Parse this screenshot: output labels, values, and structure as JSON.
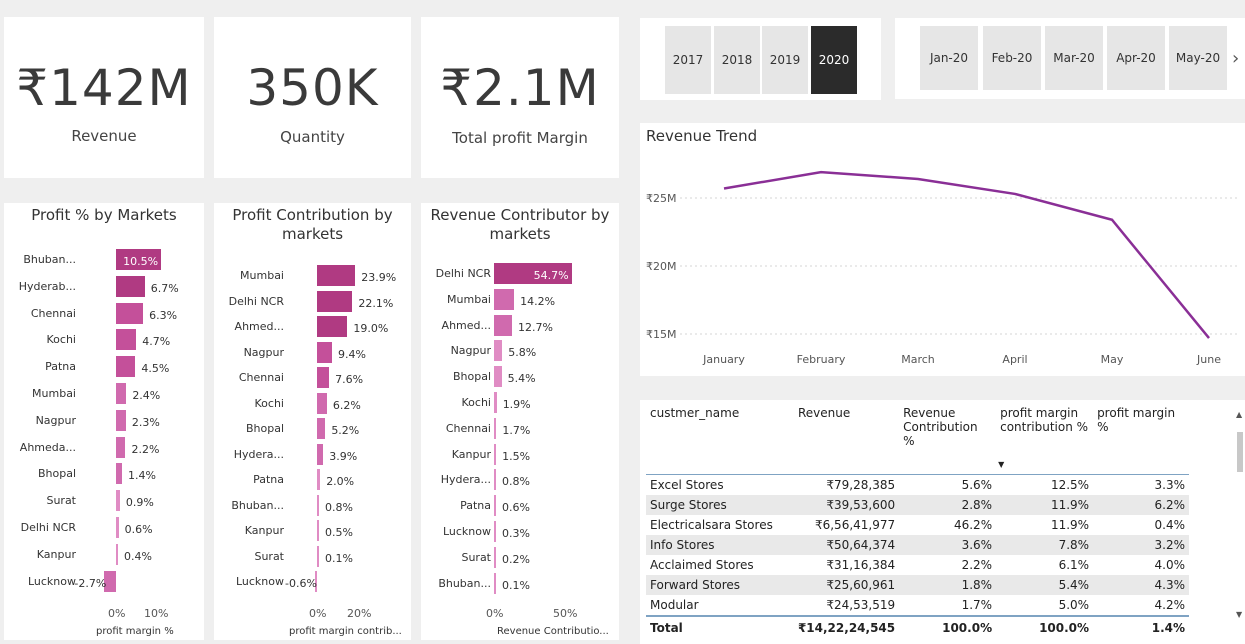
{
  "kpis": [
    {
      "value": "₹142M",
      "label": "Revenue"
    },
    {
      "value": "350K",
      "label": "Quantity"
    },
    {
      "value": "₹2.1M",
      "label": "Total profit Margin"
    }
  ],
  "slicers": {
    "years": [
      "2017",
      "2018",
      "2019",
      "2020"
    ],
    "selected_year": "2020",
    "months": [
      "Jan-20",
      "Feb-20",
      "Mar-20",
      "Apr-20",
      "May-20"
    ]
  },
  "colors": {
    "bar_strong": "#b03a82",
    "bar_mid": "#c4509a",
    "bar_light": "#e08cc4",
    "line": "#8a2f96",
    "selected_btn": "#2b2b2b"
  },
  "chart_data": [
    {
      "type": "bar",
      "orientation": "horizontal",
      "title": "Profit % by Markets",
      "xlabel": "profit margin %",
      "categories": [
        "Bhuban...",
        "Hyderab...",
        "Chennai",
        "Kochi",
        "Patna",
        "Mumbai",
        "Nagpur",
        "Ahmeda...",
        "Bhopal",
        "Surat",
        "Delhi NCR",
        "Kanpur",
        "Lucknow"
      ],
      "values": [
        10.5,
        6.7,
        6.3,
        4.7,
        4.5,
        2.4,
        2.3,
        2.2,
        1.4,
        0.9,
        0.6,
        0.4,
        -2.7
      ],
      "labels": [
        "10.5%",
        "6.7%",
        "6.3%",
        "4.7%",
        "4.5%",
        "2.4%",
        "2.3%",
        "2.2%",
        "1.4%",
        "0.9%",
        "0.6%",
        "0.4%",
        "-2.7%"
      ],
      "ticks": [
        "0%",
        "10%"
      ],
      "xlim": [
        -3,
        12
      ]
    },
    {
      "type": "bar",
      "orientation": "horizontal",
      "title": "Profit Contribution by markets",
      "xlabel": "profit margin contrib...",
      "categories": [
        "Mumbai",
        "Delhi NCR",
        "Ahmed...",
        "Nagpur",
        "Chennai",
        "Kochi",
        "Bhopal",
        "Hydera...",
        "Patna",
        "Bhuban...",
        "Kanpur",
        "Surat",
        "Lucknow"
      ],
      "values": [
        23.9,
        22.1,
        19.0,
        9.4,
        7.6,
        6.2,
        5.2,
        3.9,
        2.0,
        0.8,
        0.5,
        0.1,
        -0.6
      ],
      "labels": [
        "23.9%",
        "22.1%",
        "19.0%",
        "9.4%",
        "7.6%",
        "6.2%",
        "5.2%",
        "3.9%",
        "2.0%",
        "0.8%",
        "0.5%",
        "0.1%",
        "-0.6%"
      ],
      "ticks": [
        "0%",
        "20%"
      ],
      "xlim": [
        -2,
        25
      ]
    },
    {
      "type": "bar",
      "orientation": "horizontal",
      "title": "Revenue Contributor by markets",
      "xlabel": "Revenue Contributio...",
      "categories": [
        "Delhi NCR",
        "Mumbai",
        "Ahmed...",
        "Nagpur",
        "Bhopal",
        "Kochi",
        "Chennai",
        "Kanpur",
        "Hydera...",
        "Patna",
        "Lucknow",
        "Surat",
        "Bhuban..."
      ],
      "values": [
        54.7,
        14.2,
        12.7,
        5.8,
        5.4,
        1.9,
        1.7,
        1.5,
        0.8,
        0.6,
        0.3,
        0.2,
        0.1
      ],
      "labels": [
        "54.7%",
        "14.2%",
        "12.7%",
        "5.8%",
        "5.4%",
        "1.9%",
        "1.7%",
        "1.5%",
        "0.8%",
        "0.6%",
        "0.3%",
        "0.2%",
        "0.1%"
      ],
      "ticks": [
        "0%",
        "50%"
      ],
      "xlim": [
        0,
        56
      ]
    },
    {
      "type": "line",
      "title": "Revenue Trend",
      "categories": [
        "January",
        "February",
        "March",
        "April",
        "May",
        "June"
      ],
      "values": [
        25.7,
        26.9,
        26.4,
        25.3,
        23.4,
        14.7
      ],
      "yticks": [
        "₹25M",
        "₹20M",
        "₹15M"
      ],
      "ylim": [
        14,
        27.5
      ]
    }
  ],
  "table": {
    "headers": [
      "custmer_name",
      "Revenue",
      "Revenue Contribution %",
      "profit margin contribution %",
      "profit margin %"
    ],
    "rows": [
      [
        "Excel Stores",
        "₹79,28,385",
        "5.6%",
        "12.5%",
        "3.3%"
      ],
      [
        "Surge Stores",
        "₹39,53,600",
        "2.8%",
        "11.9%",
        "6.2%"
      ],
      [
        "Electricalsara Stores",
        "₹6,56,41,977",
        "46.2%",
        "11.9%",
        "0.4%"
      ],
      [
        "Info Stores",
        "₹50,64,374",
        "3.6%",
        "7.8%",
        "3.2%"
      ],
      [
        "Acclaimed Stores",
        "₹31,16,384",
        "2.2%",
        "6.1%",
        "4.0%"
      ],
      [
        "Forward Stores",
        "₹25,60,961",
        "1.8%",
        "5.4%",
        "4.3%"
      ],
      [
        "Modular",
        "₹24,53,519",
        "1.7%",
        "5.0%",
        "4.2%"
      ]
    ],
    "total": [
      "Total",
      "₹14,22,24,545",
      "100.0%",
      "100.0%",
      "1.4%"
    ]
  }
}
